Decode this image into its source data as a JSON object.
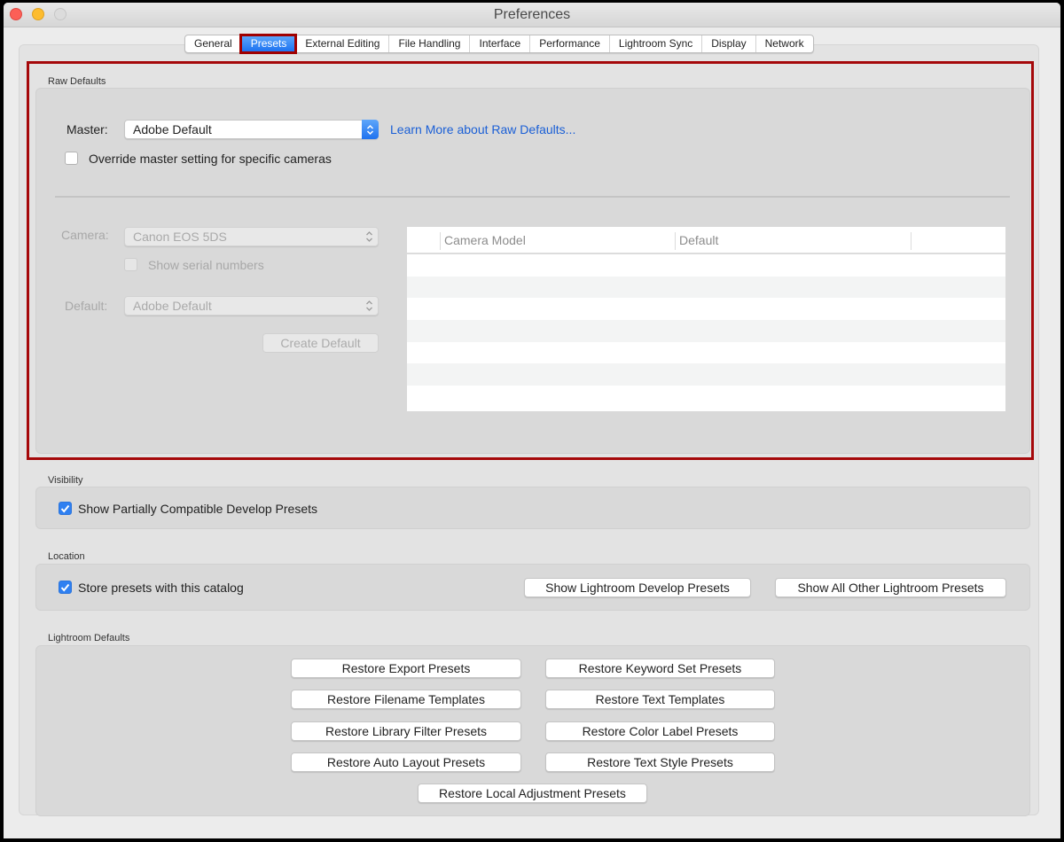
{
  "window": {
    "title": "Preferences"
  },
  "tabs": [
    {
      "label": "General",
      "active": false
    },
    {
      "label": "Presets",
      "active": true
    },
    {
      "label": "External Editing",
      "active": false
    },
    {
      "label": "File Handling",
      "active": false
    },
    {
      "label": "Interface",
      "active": false
    },
    {
      "label": "Performance",
      "active": false
    },
    {
      "label": "Lightroom Sync",
      "active": false
    },
    {
      "label": "Display",
      "active": false
    },
    {
      "label": "Network",
      "active": false
    }
  ],
  "raw_defaults": {
    "section_label": "Raw Defaults",
    "master_label": "Master:",
    "master_value": "Adobe Default",
    "learn_more_link": "Learn More about Raw Defaults...",
    "override_checkbox": {
      "label": "Override master setting for specific cameras",
      "checked": false
    },
    "camera_label": "Camera:",
    "camera_value": "Canon EOS 5DS",
    "show_serial_checkbox": {
      "label": "Show serial numbers",
      "checked": false,
      "enabled": false
    },
    "default_label": "Default:",
    "default_value": "Adobe Default",
    "create_default_button": "Create Default",
    "table": {
      "columns": [
        "",
        "Camera Model",
        "Default",
        ""
      ],
      "rows": []
    }
  },
  "visibility": {
    "section_label": "Visibility",
    "show_partial_checkbox": {
      "label": "Show Partially Compatible Develop Presets",
      "checked": true
    }
  },
  "location": {
    "section_label": "Location",
    "store_presets_checkbox": {
      "label": "Store presets with this catalog",
      "checked": true
    },
    "show_develop_button": "Show Lightroom Develop Presets",
    "show_other_button": "Show All Other Lightroom Presets"
  },
  "lightroom_defaults": {
    "section_label": "Lightroom Defaults",
    "buttons": [
      "Restore Export Presets",
      "Restore Keyword Set Presets",
      "Restore Filename Templates",
      "Restore Text Templates",
      "Restore Library Filter Presets",
      "Restore Color Label Presets",
      "Restore Auto Layout Presets",
      "Restore Text Style Presets",
      "Restore Local Adjustment Presets"
    ]
  },
  "colors": {
    "accent": "#1f72ef",
    "link": "#1a5fd6",
    "highlight_outline": "#a5080a"
  }
}
